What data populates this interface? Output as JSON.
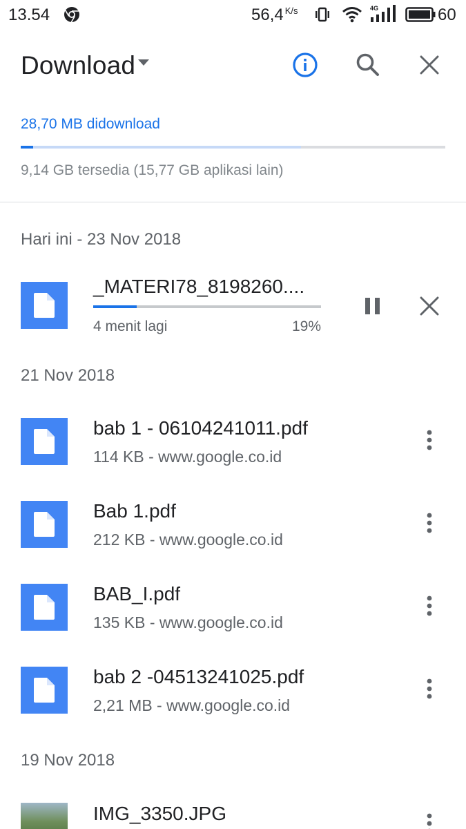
{
  "status_bar": {
    "time": "13.54",
    "net_speed": "56,4",
    "net_speed_unit": "K/s",
    "battery": "60",
    "network_type": "4G",
    "icons": [
      "chrome-icon",
      "vibrate-icon",
      "wifi-icon",
      "signal-icon",
      "battery-icon"
    ]
  },
  "header": {
    "title": "Download",
    "icons": [
      "info-icon",
      "search-icon",
      "close-icon"
    ]
  },
  "storage": {
    "used_label": "28,70 MB didownload",
    "available_label": "9,14 GB tersedia (15,77 GB aplikasi lain)",
    "downloaded_fraction": 0.03,
    "other_apps_fraction": 0.66
  },
  "sections": [
    {
      "date": "Hari ini - 23 Nov 2018",
      "items": [
        {
          "name": "_MATERI78_8198260....",
          "status": "4 menit lagi",
          "progress_label": "19%",
          "progress": 0.19
        }
      ]
    },
    {
      "date": "21 Nov 2018",
      "items": [
        {
          "name": "bab 1 - 06104241011.pdf",
          "meta": "114 KB - www.google.co.id"
        },
        {
          "name": "Bab 1.pdf",
          "meta": "212 KB - www.google.co.id"
        },
        {
          "name": "BAB_I.pdf",
          "meta": "135 KB - www.google.co.id"
        },
        {
          "name": "bab 2 -04513241025.pdf",
          "meta": "2,21 MB - www.google.co.id"
        }
      ]
    },
    {
      "date": "19 Nov 2018",
      "items": [
        {
          "name": "IMG_3350.JPG"
        }
      ]
    }
  ],
  "colors": {
    "accent": "#1a73e8",
    "file_icon": "#4285f4",
    "secondary_text": "#5f6368"
  }
}
